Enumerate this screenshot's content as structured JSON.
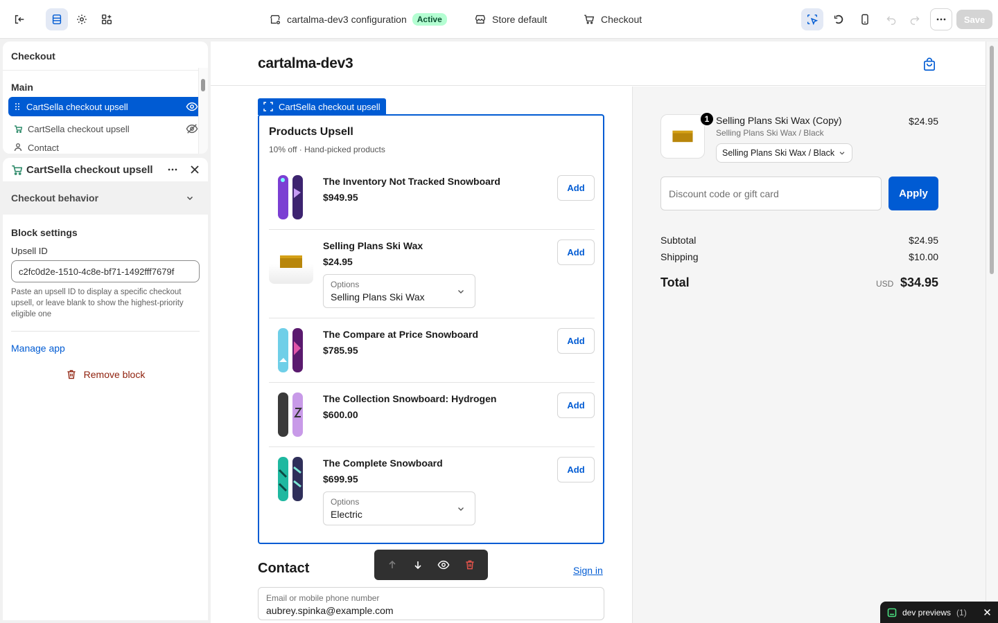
{
  "topbar": {
    "config_title": "cartalma-dev3 configuration",
    "status_badge": "Active",
    "store_label": "Store default",
    "page_label": "Checkout",
    "save_label": "Save"
  },
  "sidebar": {
    "header": "Checkout",
    "section": "Main",
    "items": [
      {
        "label": "CartSella checkout upsell",
        "selected": true,
        "icon": "drag-handle-icon",
        "visibility": "eye-icon"
      },
      {
        "label": "CartSella checkout upsell",
        "selected": false,
        "icon": "app-icon",
        "visibility": "eye-hidden-icon"
      },
      {
        "label": "Contact",
        "selected": false,
        "icon": "person-icon"
      }
    ]
  },
  "block_panel": {
    "title": "CartSella checkout upsell",
    "accordion": "Checkout behavior",
    "settings_heading": "Block settings",
    "upsell_label": "Upsell ID",
    "upsell_value": "c2fc0d2e-1510-4c8e-bf71-1492fff7679f",
    "help_text": "Paste an upsell ID to display a specific checkout upsell, or leave blank to show the highest-priority eligible one",
    "manage_app": "Manage app",
    "remove_block": "Remove block"
  },
  "preview": {
    "store_name": "cartalma-dev3",
    "block_tag": "CartSella checkout upsell",
    "upsell": {
      "title": "Products Upsell",
      "subtitle": "10% off · Hand-picked products",
      "add_label": "Add",
      "options_label": "Options",
      "products": [
        {
          "name": "The Inventory Not Tracked Snowboard",
          "price": "$949.95"
        },
        {
          "name": "Selling Plans Ski Wax",
          "price": "$24.95",
          "option": "Selling Plans Ski Wax"
        },
        {
          "name": "The Compare at Price Snowboard",
          "price": "$785.95"
        },
        {
          "name": "The Collection Snowboard: Hydrogen",
          "price": "$600.00"
        },
        {
          "name": "The Complete Snowboard",
          "price": "$699.95",
          "option": "Electric"
        }
      ]
    },
    "contact": {
      "heading": "Contact",
      "sign_in": "Sign in",
      "email_label": "Email or mobile phone number",
      "email_value": "aubrey.spinka@example.com"
    },
    "summary": {
      "line_item": {
        "qty": "1",
        "name": "Selling Plans Ski Wax (Copy)",
        "variant": "Selling Plans Ski Wax / Black",
        "price": "$24.95",
        "variant_select": "Selling Plans Ski Wax / Black"
      },
      "discount_placeholder": "Discount code or gift card",
      "apply_label": "Apply",
      "subtotal_label": "Subtotal",
      "subtotal_value": "$24.95",
      "shipping_label": "Shipping",
      "shipping_value": "$10.00",
      "total_label": "Total",
      "currency": "USD",
      "total_value": "$34.95"
    }
  },
  "toast": {
    "label": "dev previews",
    "count": "(1)"
  },
  "colors": {
    "accent": "#005bd3",
    "danger": "#8e1f0b",
    "active_badge": "#b4fed2"
  }
}
